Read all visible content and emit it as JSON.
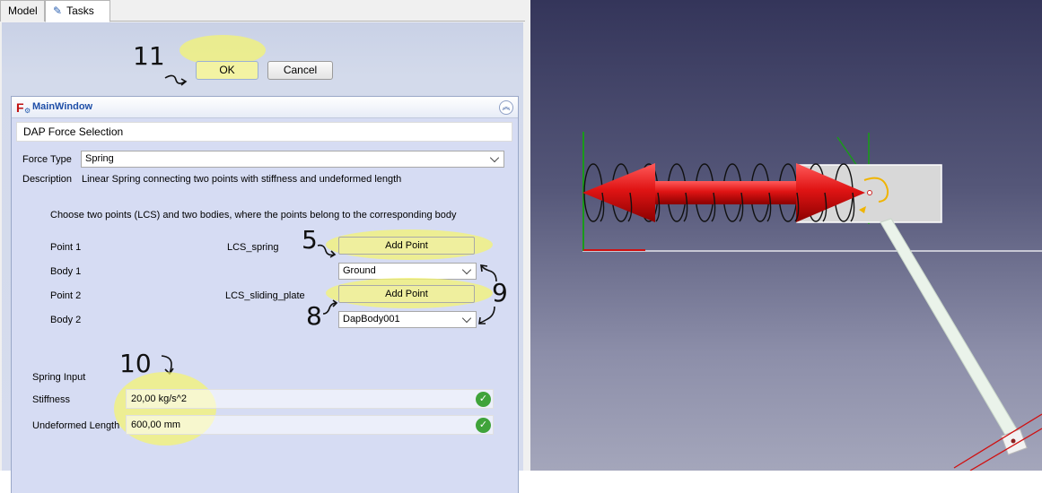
{
  "tabs": {
    "model": "Model",
    "tasks": "Tasks"
  },
  "buttons": {
    "ok": "OK",
    "cancel": "Cancel"
  },
  "panel": {
    "title": "MainWindow",
    "dialog_title": "DAP Force Selection"
  },
  "force": {
    "type_label": "Force Type",
    "type_value": "Spring",
    "description_label": "Description",
    "description_value": "Linear Spring connecting two points with stiffness and undeformed length"
  },
  "instructions": "Choose two points (LCS) and two bodies, where the points belong to the corresponding body",
  "point1": {
    "label": "Point 1",
    "value": "LCS_spring",
    "button": "Add Point"
  },
  "body1": {
    "label": "Body 1",
    "value": "Ground"
  },
  "point2": {
    "label": "Point 2",
    "value": "LCS_sliding_plate",
    "button": "Add Point"
  },
  "body2": {
    "label": "Body 2",
    "value": "DapBody001"
  },
  "spring_input": {
    "heading": "Spring Input",
    "stiffness_label": "Stiffness",
    "stiffness_value": "20,00 kg/s^2",
    "length_label": "Undeformed Length",
    "length_value": "600,00 mm"
  },
  "annotations": {
    "n5": "5",
    "n8": "8",
    "n9": "9",
    "n10": "10",
    "n11": "11"
  },
  "colors": {
    "highlight": "#f5f56e",
    "arrow_red": "#d81010",
    "check_green": "#3fa33a"
  }
}
